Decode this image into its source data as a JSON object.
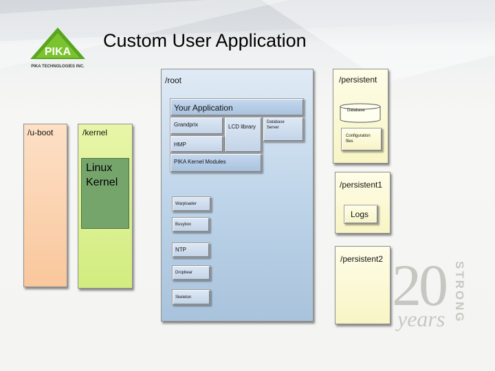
{
  "title": "Custom User Application",
  "logo": {
    "company": "PIKA TECHNOLOGIES INC."
  },
  "watermark": {
    "number": "20",
    "word_side": "STRONG",
    "word_bottom": "years"
  },
  "colors": {
    "uboot": "#f9c79c",
    "kernel": "#d3ec80",
    "linux_kernel": "#76a56c",
    "root": "#bcd3e8",
    "persistent": "#f8f5c5",
    "module": "#a9c2df"
  },
  "boot": {
    "uboot_label": "/u-boot"
  },
  "kernel": {
    "label": "/kernel",
    "linux_label": "Linux Kernel"
  },
  "root": {
    "label": "/root",
    "your_application": "Your Application",
    "grandprix": "Grandprix",
    "lcd_library": "LCD library",
    "database_server": "Database Server",
    "hmp": "HMP",
    "pika_kernel_modules": "PIKA Kernel Modules",
    "warploader": "Warploader",
    "busybox": "Busybox",
    "ntp": "NTP",
    "dropbear": "Dropbear",
    "skeleton": "Skeleton"
  },
  "persistent": {
    "label": "/persistent",
    "database": "Database",
    "config_files": "Configuration files"
  },
  "persistent1": {
    "label": "/persistent1",
    "logs": "Logs"
  },
  "persistent2": {
    "label": "/persistent2"
  }
}
